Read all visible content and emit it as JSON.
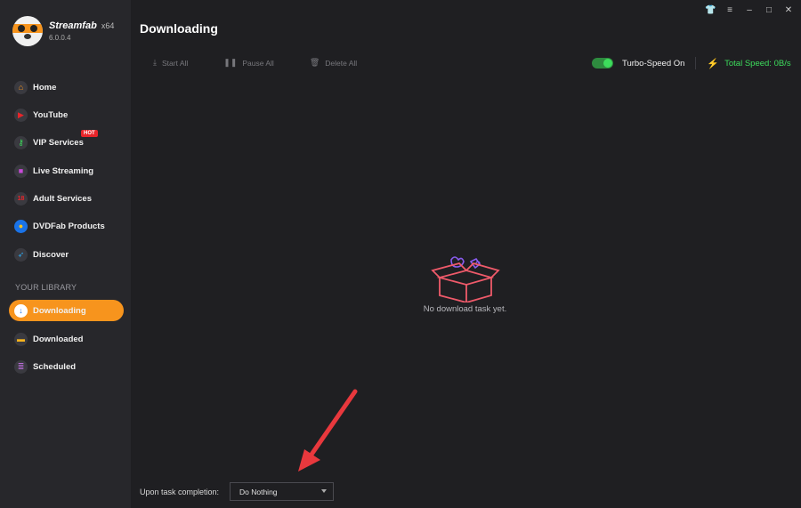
{
  "app": {
    "name": "Streamfab",
    "arch": "x64",
    "version": "6.0.0.4"
  },
  "sidebar": {
    "items": [
      {
        "label": "Home",
        "icon": "home-icon",
        "color": "#f7941d"
      },
      {
        "label": "YouTube",
        "icon": "youtube-icon",
        "color": "#e8252a"
      },
      {
        "label": "VIP Services",
        "icon": "key-icon",
        "color": "#3ddc5c",
        "badge": "HOT"
      },
      {
        "label": "Live Streaming",
        "icon": "video-camera-icon",
        "color": "#c84bd8"
      },
      {
        "label": "Adult Services",
        "icon": "adult-18-icon",
        "color": "#e8252a"
      },
      {
        "label": "DVDFab Products",
        "icon": "dvdfab-icon",
        "color": "#1a73e8"
      },
      {
        "label": "Discover",
        "icon": "compass-icon",
        "color": "#2fa3e8"
      }
    ],
    "library_label": "YOUR LIBRARY",
    "library": [
      {
        "label": "Downloading",
        "icon": "download-arrow-icon",
        "active": true
      },
      {
        "label": "Downloaded",
        "icon": "folder-icon",
        "color": "#f7b31d"
      },
      {
        "label": "Scheduled",
        "icon": "list-icon",
        "color": "#b86bd8"
      }
    ]
  },
  "window_controls": {
    "icons": [
      "shirt-icon",
      "menu-icon",
      "minimize-icon",
      "maximize-icon",
      "close-icon"
    ],
    "glyphs": [
      "👕",
      "≡",
      "–",
      "□",
      "✕"
    ]
  },
  "header": {
    "title": "Downloading"
  },
  "toolbar": {
    "start_all": "Start All",
    "pause_all": "Pause All",
    "delete_all": "Delete All",
    "turbo_label": "Turbo-Speed On",
    "turbo_enabled": true,
    "total_speed": "Total Speed: 0B/s"
  },
  "main": {
    "empty_message": "No download task yet."
  },
  "footer": {
    "completion_label": "Upon task completion:",
    "completion_value": "Do Nothing"
  },
  "colors": {
    "accent": "#f7941d",
    "success": "#3ddc5c",
    "annotation_arrow": "#e8383d"
  }
}
